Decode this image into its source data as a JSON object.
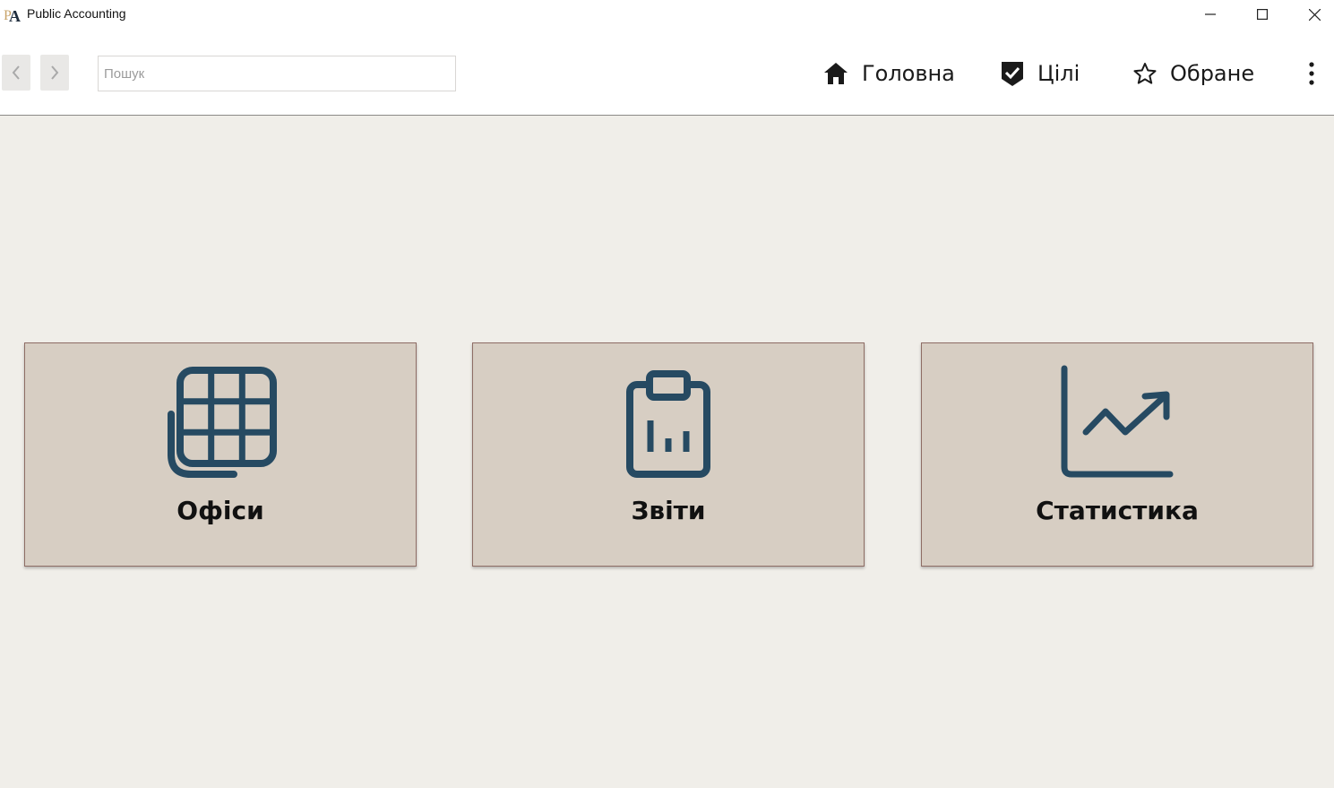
{
  "window": {
    "title": "Public Accounting",
    "logo_icon": "app-logo-pa",
    "controls": [
      "minimize-icon",
      "maximize-icon",
      "close-icon"
    ]
  },
  "toolbar": {
    "back_icon": "chevron-left-icon",
    "forward_icon": "chevron-right-icon",
    "search": {
      "placeholder": "Пошук",
      "value": ""
    },
    "links": [
      {
        "label": "Головна",
        "icon": "home-icon"
      },
      {
        "label": "Цілі",
        "icon": "shield-check-icon"
      },
      {
        "label": "Обране",
        "icon": "star-outline-icon"
      }
    ],
    "more_icon": "more-vertical-icon"
  },
  "tiles": [
    {
      "label": "Офіси",
      "icon": "grid-table-icon"
    },
    {
      "label": "Звіти",
      "icon": "clipboard-chart-icon"
    },
    {
      "label": "Статистика",
      "icon": "trending-up-chart-icon"
    }
  ],
  "colors": {
    "background": "#f0eee9",
    "bar_background": "#ffffff",
    "tile_background": "#d7cec3",
    "tile_border": "#8e6d65",
    "icon_accent": "#264a62",
    "text": "#111111"
  }
}
